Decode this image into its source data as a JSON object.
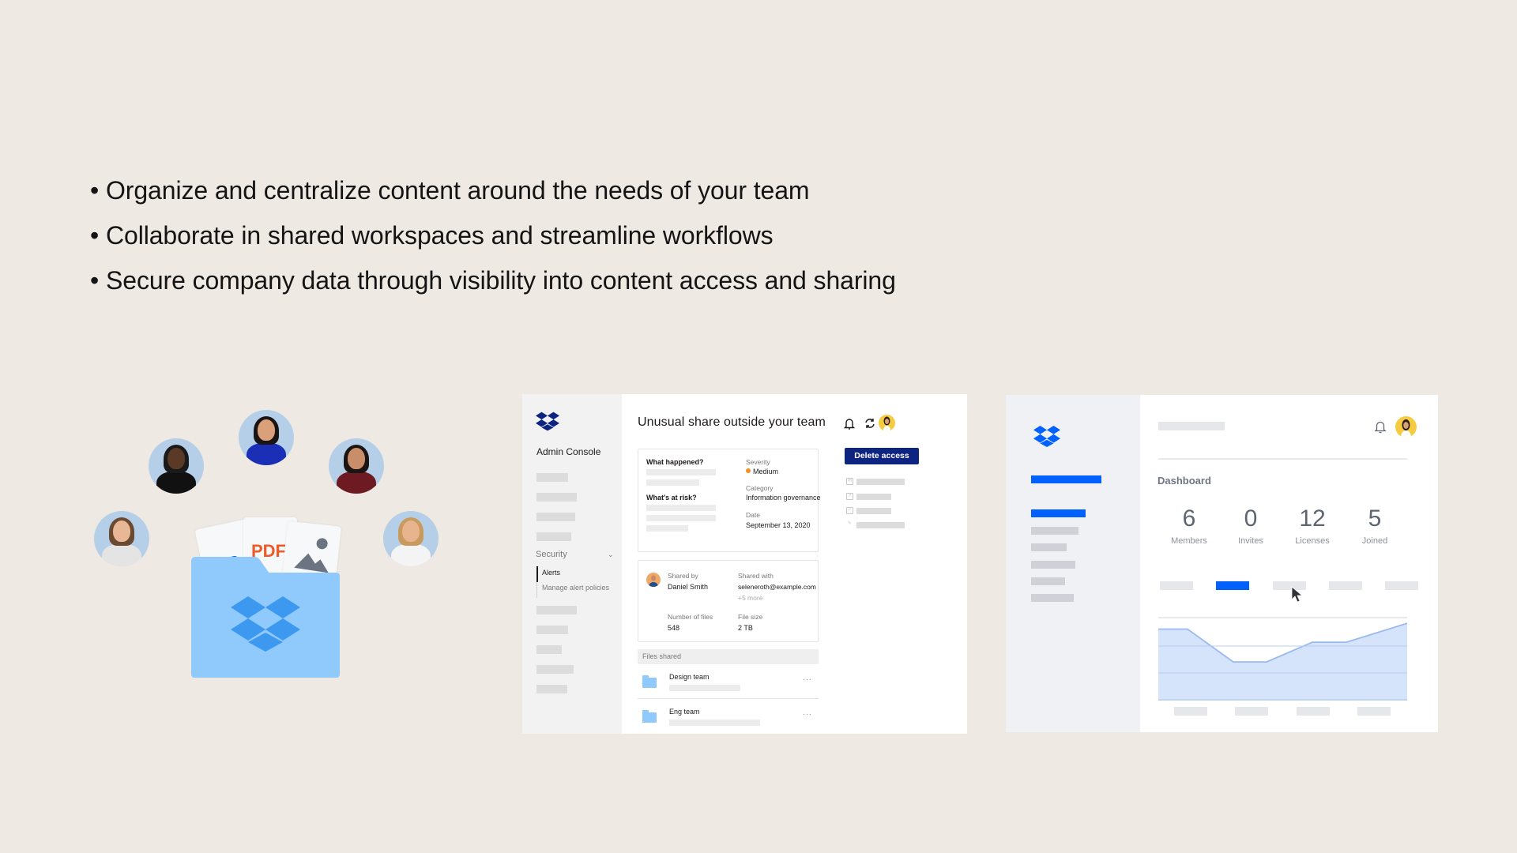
{
  "bullets": [
    "Organize and centralize content around the needs of your team",
    "Collaborate in shared workspaces and streamline workflows",
    "Secure company data through visibility into content access and sharing"
  ],
  "illustration": {
    "avatars": [
      {
        "name": "team-member-1",
        "skin": "#e8b896",
        "shirt": "#e4e4e4",
        "hair": "#6b4a32"
      },
      {
        "name": "team-member-2",
        "skin": "#5a3a26",
        "shirt": "#111111",
        "hair": "#1a1a1a"
      },
      {
        "name": "team-member-3",
        "skin": "#d9a07a",
        "shirt": "#1a2fb5",
        "hair": "#1a1412"
      },
      {
        "name": "team-member-4",
        "skin": "#c98d6a",
        "shirt": "#6e1a22",
        "hair": "#1a1412"
      },
      {
        "name": "team-member-5",
        "skin": "#e7b48d",
        "shirt": "#f4f4f4",
        "hair": "#c99a5e"
      }
    ],
    "file_labels": {
      "ps": "PS",
      "pdf": "PDF"
    }
  },
  "admin_console": {
    "sidebar_title": "Admin Console",
    "section_label": "Security",
    "nav_items": [
      {
        "label": "Alerts",
        "active": true
      },
      {
        "label": "Manage alert policies",
        "active": false
      }
    ],
    "page_title": "Unusual share outside your team",
    "delete_button": "Delete access",
    "details": {
      "what_happened_label": "What happened?",
      "whats_at_risk_label": "What's at risk?",
      "severity_label": "Severity",
      "severity_value": "Medium",
      "severity_color": "#f68f1e",
      "category_label": "Category",
      "category_value": "Information governance",
      "date_label": "Date",
      "date_value": "September 13, 2020"
    },
    "share_info": {
      "shared_by_label": "Shared by",
      "shared_by_value": "Daniel Smith",
      "shared_with_label": "Shared with",
      "shared_with_value": "seleneroth@example.com",
      "shared_with_more": "+5 more",
      "num_files_label": "Number of files",
      "num_files_value": "548",
      "file_size_label": "File size",
      "file_size_value": "2 TB"
    },
    "files_shared_header": "Files shared",
    "files": [
      {
        "name": "Design team",
        "more": "···"
      },
      {
        "name": "Eng team",
        "more": "···"
      }
    ],
    "accent_color": "#0d2481"
  },
  "dashboard": {
    "title": "Dashboard",
    "stats": [
      {
        "value": "6",
        "label": "Members"
      },
      {
        "value": "0",
        "label": "Invites"
      },
      {
        "value": "12",
        "label": "Licenses"
      },
      {
        "value": "5",
        "label": "Joined"
      }
    ],
    "active_tab_index": 1,
    "accent_color": "#0061fe",
    "chart": {
      "type": "area",
      "relative_values": [
        0.87,
        0.87,
        0.47,
        0.47,
        0.71,
        0.71,
        0.94
      ],
      "fill": "#d5e4fb",
      "line": "#9ab9ef"
    }
  }
}
